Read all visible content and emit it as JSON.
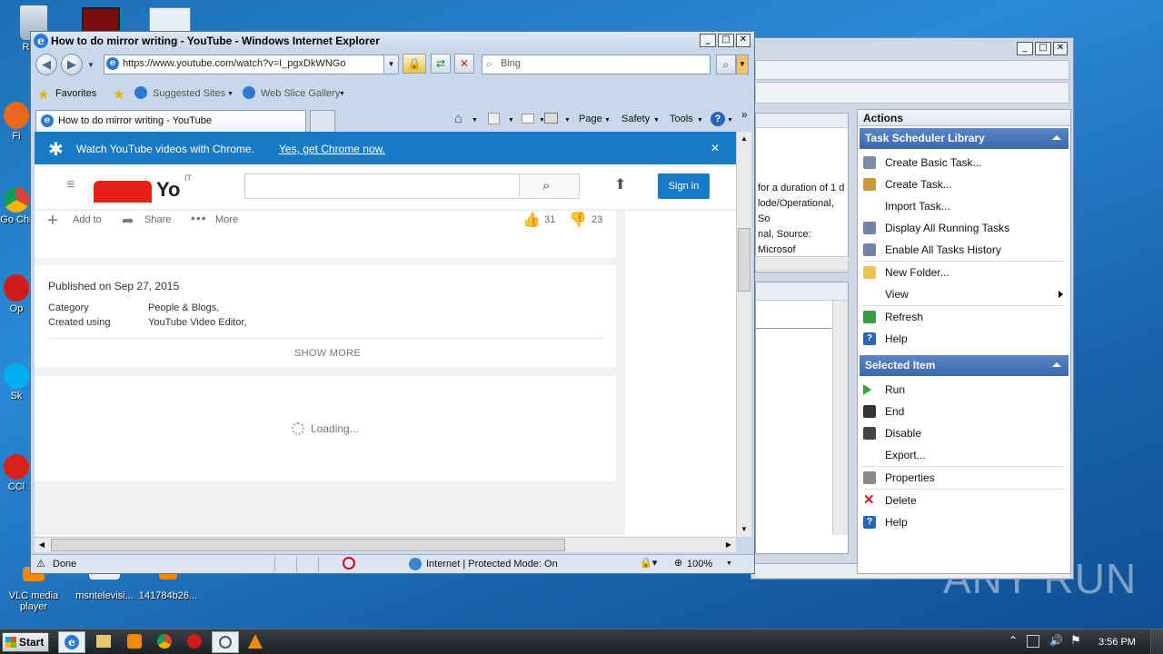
{
  "desktop": {
    "icons": [
      {
        "label": "Recy"
      },
      {
        "label": "Fi"
      },
      {
        "label": "Go Chr"
      },
      {
        "label": "Op"
      },
      {
        "label": "Sk"
      },
      {
        "label": "CCl"
      },
      {
        "label": "VLC media player"
      },
      {
        "label": "msntelevisi..."
      },
      {
        "label": "141784b26..."
      }
    ],
    "watermark": "ANY RUN"
  },
  "task_scheduler": {
    "actions_header": "Actions",
    "log_lines": [
      "for a duration of 1 d",
      "lode/Operational, So",
      "nal, Source: Microsof"
    ],
    "sections": [
      {
        "title": "Task Scheduler Library",
        "items": [
          {
            "label": "Create Basic Task...",
            "icon": "calendar-clock-icon"
          },
          {
            "label": "Create Task...",
            "icon": "task-icon"
          },
          {
            "label": "Import Task...",
            "icon": ""
          },
          {
            "label": "Display All Running Tasks",
            "icon": "list-icon"
          },
          {
            "label": "Enable All Tasks History",
            "icon": "history-icon"
          },
          {
            "label": "New Folder...",
            "icon": "folder-icon"
          },
          {
            "label": "View",
            "icon": "",
            "submenu": true
          },
          {
            "label": "Refresh",
            "icon": "refresh-icon"
          },
          {
            "label": "Help",
            "icon": "help-icon"
          }
        ]
      },
      {
        "title": "Selected Item",
        "items": [
          {
            "label": "Run",
            "icon": "run-icon"
          },
          {
            "label": "End",
            "icon": "end-icon"
          },
          {
            "label": "Disable",
            "icon": "disable-icon"
          },
          {
            "label": "Export...",
            "icon": ""
          },
          {
            "label": "Properties",
            "icon": "properties-icon"
          },
          {
            "label": "Delete",
            "icon": "delete-icon"
          },
          {
            "label": "Help",
            "icon": "help-icon"
          }
        ]
      }
    ]
  },
  "ie": {
    "title": "How to do mirror writing - YouTube - Windows Internet Explorer",
    "address": "https://www.youtube.com/watch?v=I_pgxDkWNGo",
    "search_placeholder": "Bing",
    "favorites": {
      "favorites_label": "Favorites",
      "suggested_sites": "Suggested Sites",
      "web_slice_gallery": "Web Slice Gallery"
    },
    "tab_title": "How to do mirror writing - YouTube",
    "command_bar": {
      "page": "Page",
      "safety": "Safety",
      "tools": "Tools"
    },
    "status": {
      "text": "Done",
      "zone": "Internet | Protected Mode: On",
      "zoom": "100%"
    }
  },
  "youtube": {
    "banner": {
      "message": "Watch YouTube videos with Chrome.",
      "link": "Yes, get Chrome now."
    },
    "country_code": "IT",
    "sign_in": "Sign in",
    "actions": {
      "add_to": "Add to",
      "share": "Share",
      "more": "More",
      "likes": "31",
      "dislikes": "23"
    },
    "description": {
      "published": "Published on Sep 27, 2015",
      "category_label": "Category",
      "category_value": "People & Blogs,",
      "created_label": "Created using",
      "created_value": "YouTube Video Editor,",
      "show_more": "SHOW MORE"
    },
    "loading": "Loading..."
  },
  "taskbar": {
    "start": "Start",
    "clock": "3:56 PM"
  }
}
